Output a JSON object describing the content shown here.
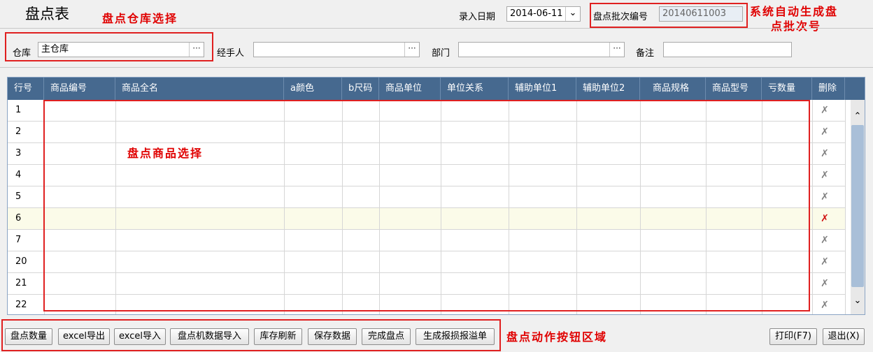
{
  "header": {
    "title": "盘点表",
    "date_label": "录入日期",
    "date_value": "2014-06-11",
    "batch_label": "盘点批次编号",
    "batch_value": "20140611003"
  },
  "annotations": {
    "warehouse_select": "盘点仓库选择",
    "batch_auto_line1": "系统自动生成盘",
    "batch_auto_line2": "点批次号",
    "goods_select": "盘点商品选择",
    "action_area": "盘点动作按钮区域"
  },
  "form": {
    "warehouse_label": "仓库",
    "warehouse_value": "主仓库",
    "handler_label": "经手人",
    "handler_value": "",
    "dept_label": "部门",
    "dept_value": "",
    "remark_label": "备注",
    "remark_value": "",
    "dots": "···"
  },
  "table": {
    "columns": [
      "行号",
      "商品编号",
      "商品全名",
      "a颜色",
      "b尺码",
      "商品单位",
      "单位关系",
      "辅助单位1",
      "辅助单位2",
      "商品规格",
      "商品型号",
      "亏数量",
      "删除"
    ],
    "rows": [
      "1",
      "2",
      "3",
      "4",
      "5",
      "6",
      "7",
      "20",
      "21",
      "22"
    ],
    "highlighted_row_index": 5
  },
  "icons": {
    "delete": "✗",
    "scroll_up": "⌃",
    "scroll_down": "⌄",
    "date_dropdown": "⌄"
  },
  "buttons": {
    "count_qty": "盘点数量",
    "excel_export": "excel导出",
    "excel_import": "excel导入",
    "device_import": "盘点机数据导入",
    "stock_refresh": "库存刷新",
    "save_data": "保存数据",
    "finish_count": "完成盘点",
    "gen_report": "生成报损报溢单",
    "print": "打印(F7)",
    "exit": "退出(X)"
  },
  "colors": {
    "header_bg": "#46698f",
    "annotation": "#e00000",
    "highlight_row": "#fbfbe9"
  }
}
